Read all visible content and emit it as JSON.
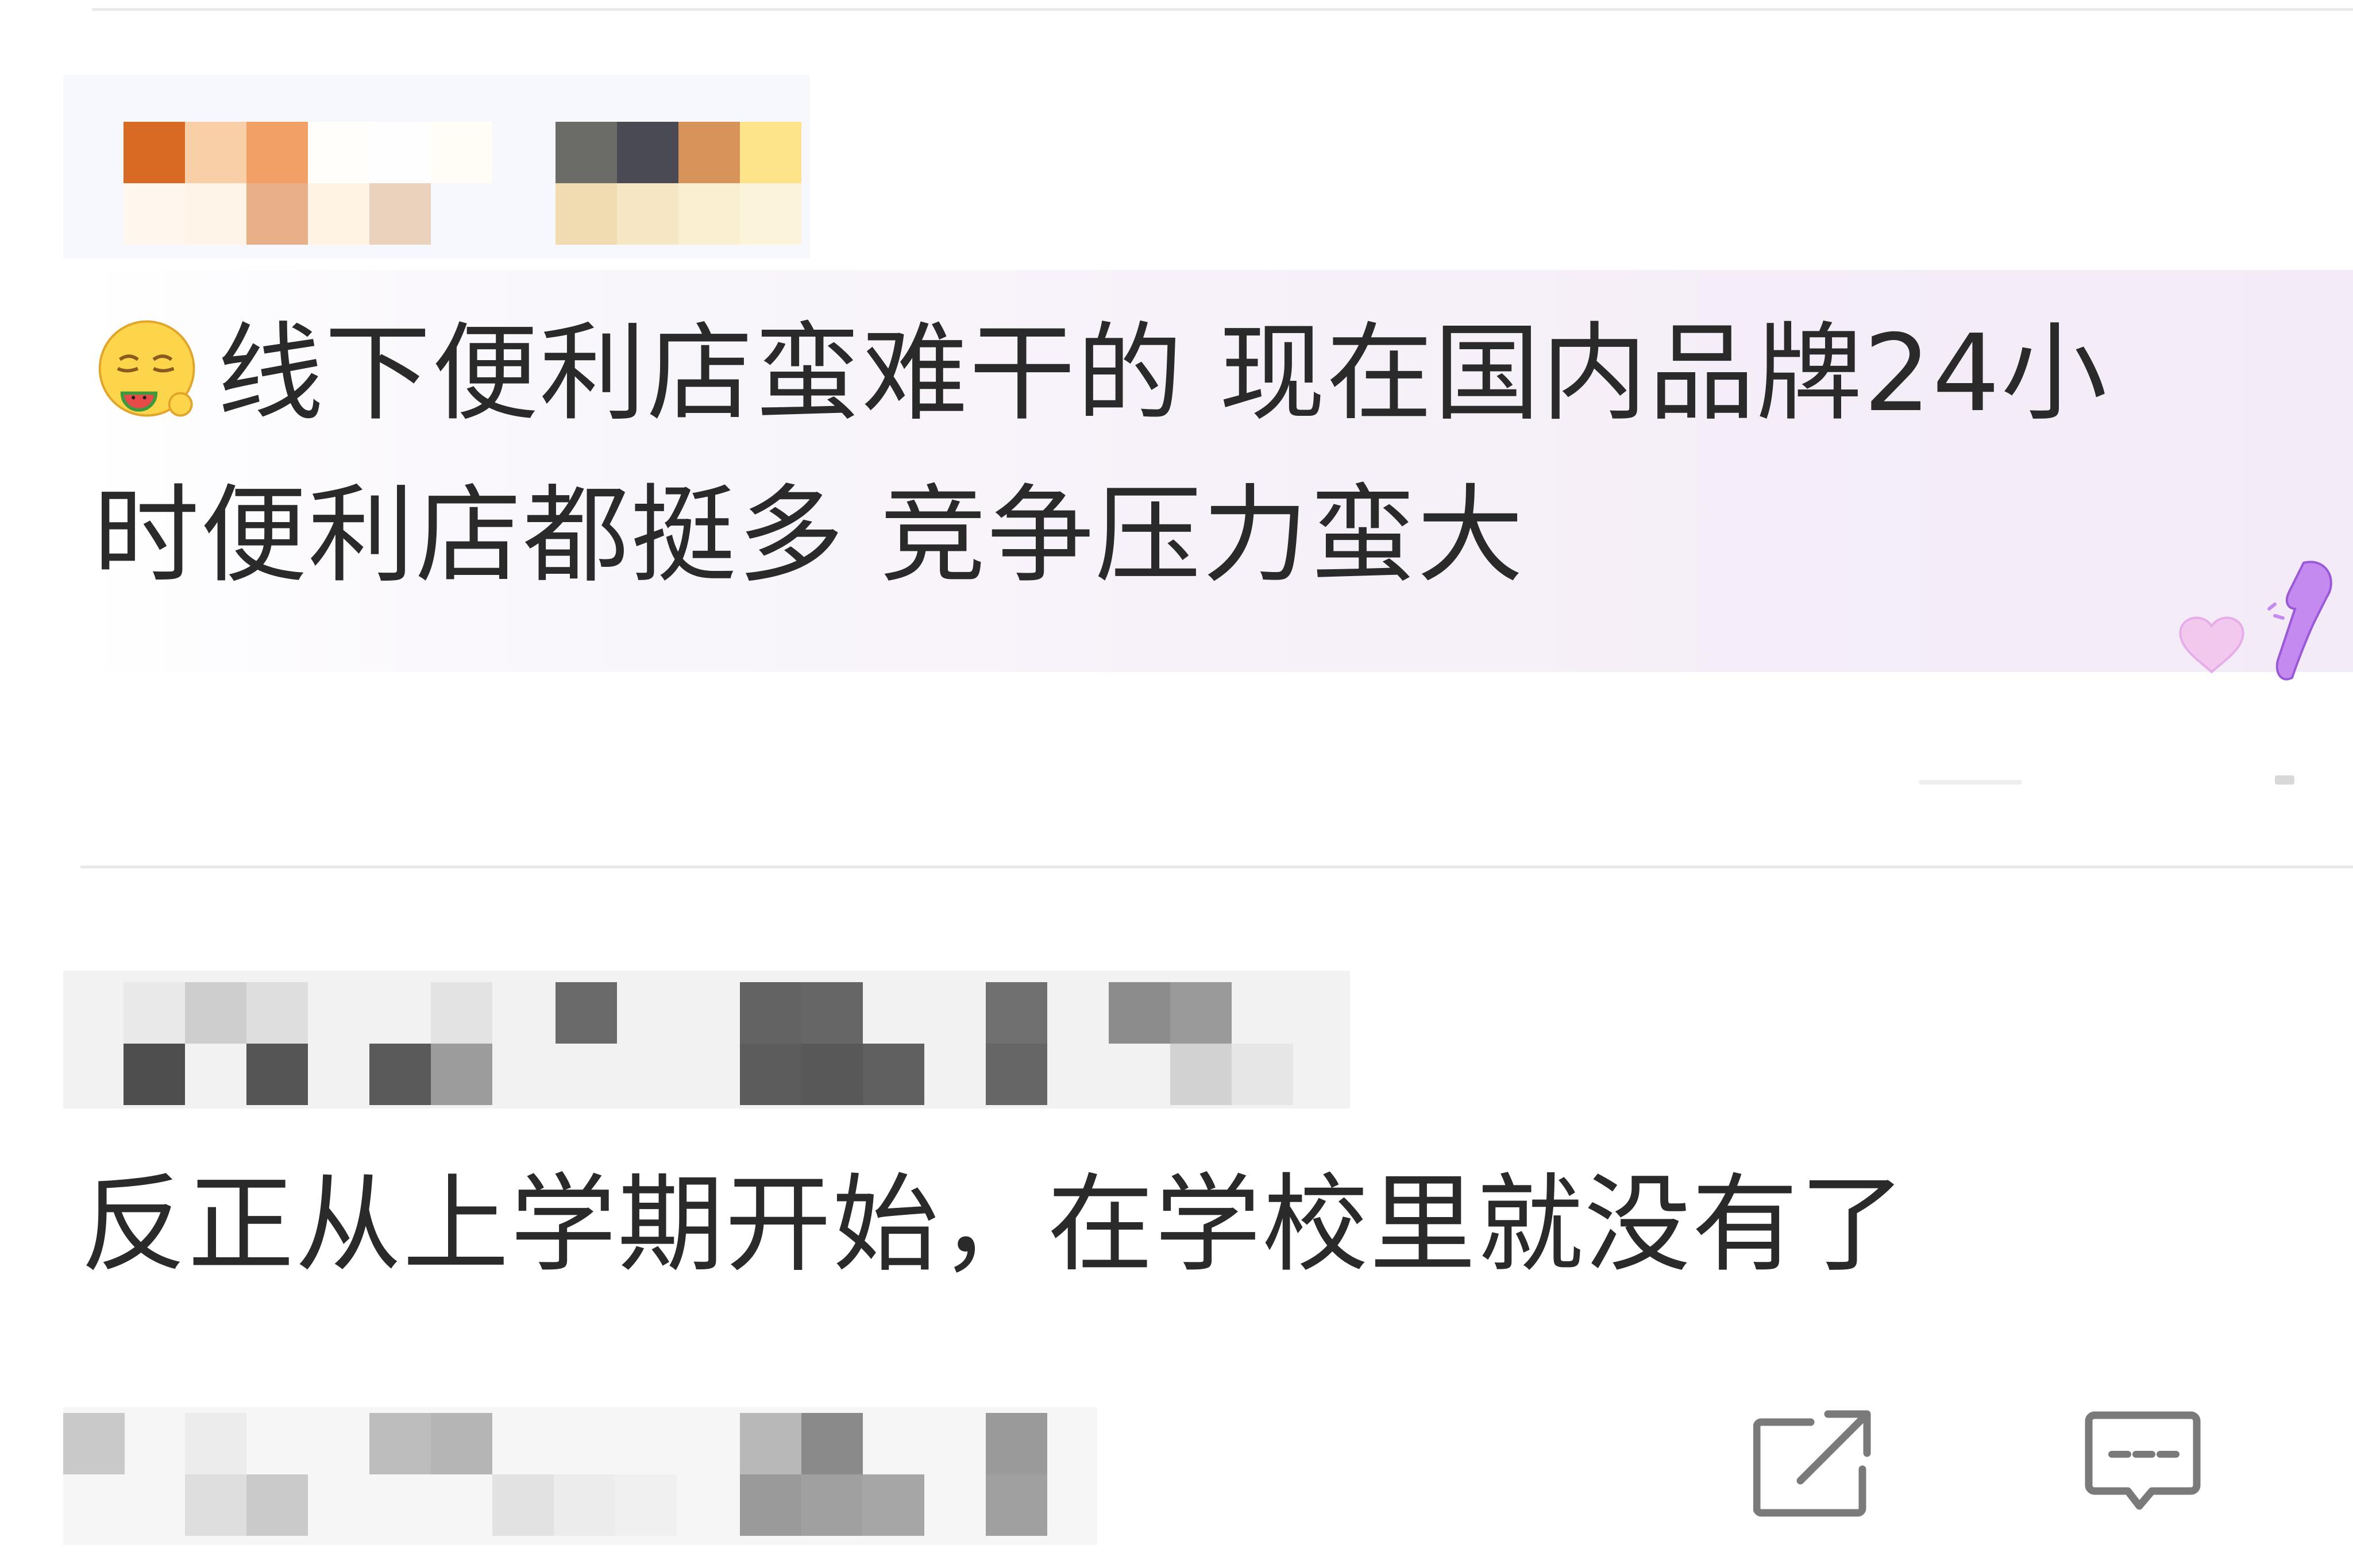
{
  "comments": [
    {
      "text_line1": "线下便利店蛮难干的 现在国内品牌24小",
      "text_line2": "时便利店都挺多 竞争压力蛮大",
      "emoji": "watermelon-eating-emoji",
      "sticker": "purple-heart-sticker"
    },
    {
      "text": "反正从上学期开始，在学校里就没有了"
    }
  ],
  "actions": {
    "share_icon": "share-external-icon",
    "comment_icon": "comment-bubble-icon"
  },
  "colors": {
    "card_tint": "#f3ebf7",
    "divider": "#e9e9ed",
    "icon_gray": "#7a7a7a",
    "sticker_purple": "#c48af0"
  }
}
